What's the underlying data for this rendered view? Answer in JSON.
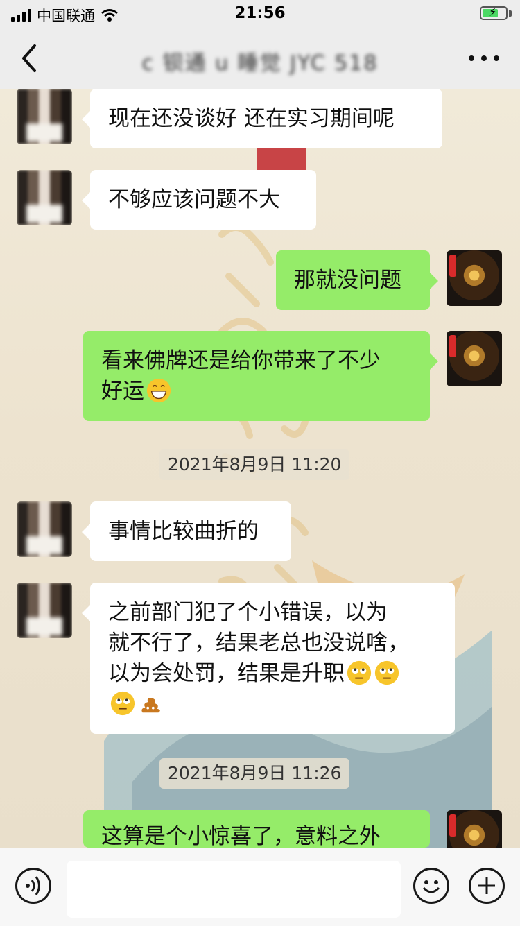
{
  "status_bar": {
    "carrier": "中国联通",
    "time": "21:56",
    "battery_level": 0.7
  },
  "nav": {
    "title": "c 钡通 u 睡觉 JYC 518",
    "back_icon": "chevron-left-icon",
    "more_icon": "ellipsis-icon"
  },
  "messages": [
    {
      "side": "left",
      "text": "现在还没谈好 还在实习期间呢"
    },
    {
      "side": "left",
      "text": "不够应该问题不大"
    },
    {
      "side": "right",
      "text": "那就没问题"
    },
    {
      "side": "right",
      "text": "看来佛牌还是给你带来了不少\n好运",
      "emojis": [
        "grin-emoji"
      ]
    },
    {
      "side": "time",
      "text": "2021年8月9日 11:20"
    },
    {
      "side": "left",
      "text": "事情比较曲折的"
    },
    {
      "side": "left",
      "text": "之前部门犯了个小错误，以为\n就不行了，结果老总也没说啥，\n以为会处罚，结果是升职",
      "emojis": [
        "eye-roll-emoji",
        "eye-roll-emoji",
        "eye-roll-emoji",
        "poop-emoji"
      ]
    },
    {
      "side": "time",
      "text": "2021年8月9日 11:26"
    },
    {
      "side": "right",
      "text": "这算是个小惊喜了，意料之外"
    }
  ],
  "input_bar": {
    "voice_icon": "voice-icon",
    "emoji_icon": "smile-icon",
    "plus_icon": "plus-icon",
    "placeholder": ""
  },
  "colors": {
    "sent_bubble": "#95ec69",
    "received_bubble": "#ffffff",
    "bar": "#ededed"
  }
}
